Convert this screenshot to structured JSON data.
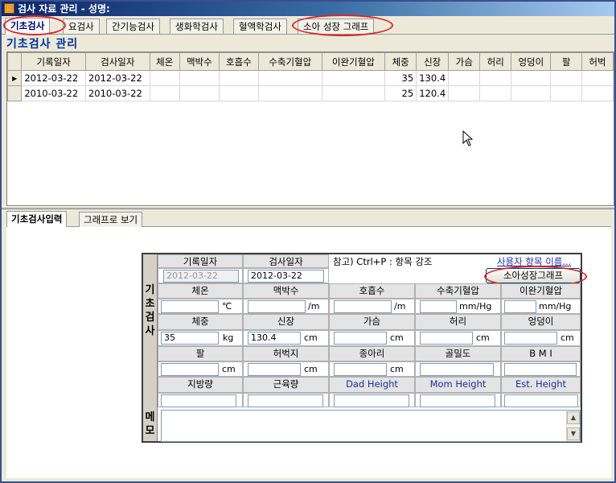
{
  "window": {
    "title": "검사 자료 관리 - 성명:"
  },
  "tabs_top": [
    {
      "label": "기초검사"
    },
    {
      "label": "요검사"
    },
    {
      "label": "간기능검사"
    },
    {
      "label": "생화학검사"
    },
    {
      "label": "혈액학검사"
    },
    {
      "label": "소아 성장 그래프"
    }
  ],
  "section_title": "기초검사 관리",
  "grid": {
    "columns": [
      "기록일자",
      "검사일자",
      "체온",
      "맥박수",
      "호흡수",
      "수축기혈압",
      "이완기혈압",
      "체중",
      "신장",
      "가슴",
      "허리",
      "엉덩이",
      "팔",
      "허벅"
    ],
    "rows": [
      [
        "2012-03-22",
        "2012-03-22",
        "",
        "",
        "",
        "",
        "",
        "35",
        "130.4",
        "",
        "",
        "",
        "",
        ""
      ],
      [
        "2010-03-22",
        "2010-03-22",
        "",
        "",
        "",
        "",
        "",
        "25",
        "120.4",
        "",
        "",
        "",
        "",
        ""
      ]
    ],
    "row_marker": "▶"
  },
  "tabs_bottom": [
    {
      "label": "기초검사입력"
    },
    {
      "label": "그래프로 보기"
    }
  ],
  "form": {
    "sidebar_main": "기초검사",
    "sidebar_memo": "메모",
    "record_date_label": "기록일자",
    "record_date_value": "2012-03-22",
    "exam_date_label": "검사일자",
    "exam_date_value": "2012-03-22",
    "note": "참고) Ctrl+P : 항목 강조",
    "user_items_link": "사용자 항목 이름...",
    "growth_button": "소아성장그래프",
    "row1": [
      {
        "label": "체온",
        "value": "",
        "unit": "℃"
      },
      {
        "label": "맥박수",
        "value": "",
        "unit": "/m"
      },
      {
        "label": "호흡수",
        "value": "",
        "unit": "/m"
      },
      {
        "label": "수축기혈압",
        "value": "",
        "unit": "mm/Hg"
      },
      {
        "label": "이완기혈압",
        "value": "",
        "unit": "mm/Hg"
      }
    ],
    "row2": [
      {
        "label": "체중",
        "value": "35",
        "unit": "kg"
      },
      {
        "label": "신장",
        "value": "130.4",
        "unit": "cm"
      },
      {
        "label": "가슴",
        "value": "",
        "unit": "cm"
      },
      {
        "label": "허리",
        "value": "",
        "unit": "cm"
      },
      {
        "label": "엉덩이",
        "value": "",
        "unit": "cm"
      }
    ],
    "row3": [
      {
        "label": "팔",
        "value": "",
        "unit": "cm"
      },
      {
        "label": "허벅지",
        "value": "",
        "unit": "cm"
      },
      {
        "label": "종아리",
        "value": "",
        "unit": "cm"
      },
      {
        "label": "골밀도",
        "value": "",
        "unit": ""
      },
      {
        "label": "B M I",
        "value": "",
        "unit": ""
      }
    ],
    "row4": [
      {
        "label": "지방량",
        "value": "",
        "blue": false
      },
      {
        "label": "근육량",
        "value": "",
        "blue": false
      },
      {
        "label": "Dad Height",
        "value": "",
        "blue": true
      },
      {
        "label": "Mom Height",
        "value": "",
        "blue": true
      },
      {
        "label": "Est. Height",
        "value": "",
        "blue": true
      }
    ]
  },
  "colors": {
    "highlight_circle": "#d9262b",
    "link_blue": "#1a2fa0",
    "title_blue": "#0030a0"
  }
}
